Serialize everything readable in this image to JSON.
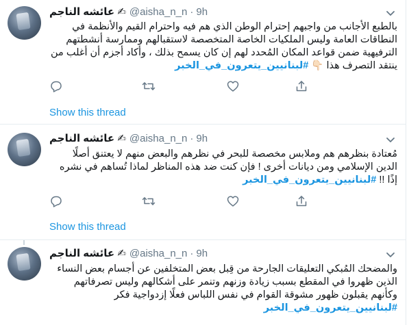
{
  "account": {
    "display_name": "عائشه الناجم ✍",
    "handle": "@aisha_n_n",
    "separator": "·"
  },
  "show_thread_label": "Show this thread",
  "colors": {
    "accent": "#1b95e0",
    "muted": "#657786",
    "border": "#e6ecf0"
  },
  "tweets": [
    {
      "time": "9h",
      "text_before": "بالطبع الأجانب من واجبهم إحترام الوطن الذي هم فيه واحترام القيم والأنظمة في النطاقات العامة وليس الملكيات الخاصة المتخصصة لاستقبالهم وممارسة أنشطتهم الترفيهية ضمن قواعد المكان المُحدد لهم إن كان يسمح بذلك ، وأكاد أجزم أن أغلب من ينتقد التصرف هذا 👇🏻 ",
      "hashtag": "#لبنانيين_يتعرون_في_الخبر",
      "text_after": ""
    },
    {
      "time": "9h",
      "text_before": "مُعتادة بنظرهم هم وملابس مخصصة للبحر في نظرهم والبعض منهم لا يعتنق أصلًا الدين الإسلامي ومن ديانات أخرى ! فإن كنت ضد هذه المناظر لماذا تُساهم في نشره إذًا !! ",
      "hashtag": "#لبنانيين_يتعرون_في_الخبر",
      "text_after": ""
    },
    {
      "time": "9h",
      "text_before": "والمضحك المُبكي التعليقات الجارحة من قِبل بعض المتخلفين عن أجسام بعض النساء الذين ظهروا في المقطع بسبب زيادة وزنهم وتنمر على أشكالهم وليس تصرفاتهم وكأنهم يقبلون ظهور مشوقة القوام في نفس اللباس فعلًا إزدواجية فكر ",
      "hashtag": "#لبنانيين_يتعرون_في_الخبر",
      "text_after": ""
    }
  ]
}
